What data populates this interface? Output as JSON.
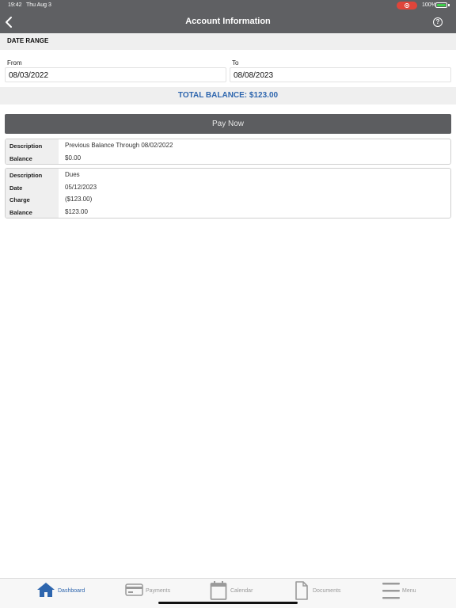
{
  "status_bar": {
    "time": "19:42",
    "date": "Thu Aug 3",
    "battery": "100%"
  },
  "nav": {
    "title": "Account Information"
  },
  "date_range": {
    "heading": "DATE RANGE",
    "from_label": "From",
    "from_value": "08/03/2022",
    "to_label": "To",
    "to_value": "08/08/2023"
  },
  "total_balance": "TOTAL BALANCE: $123.00",
  "pay_button_label": "Pay Now",
  "transactions": [
    {
      "rows": [
        {
          "key": "Description",
          "value": "Previous Balance Through 08/02/2022"
        },
        {
          "key": "Balance",
          "value": "$0.00"
        }
      ]
    },
    {
      "rows": [
        {
          "key": "Description",
          "value": "Dues"
        },
        {
          "key": "Date",
          "value": "05/12/2023"
        },
        {
          "key": "Charge",
          "value": "($123.00)"
        },
        {
          "key": "Balance",
          "value": "$123.00"
        }
      ]
    }
  ],
  "tabs": [
    {
      "label": "Dashboard",
      "icon": "home-icon",
      "active": true
    },
    {
      "label": "Payments",
      "icon": "credit-card-icon",
      "active": false
    },
    {
      "label": "Calendar",
      "icon": "calendar-icon",
      "active": false
    },
    {
      "label": "Documents",
      "icon": "document-icon",
      "active": false
    },
    {
      "label": "Menu",
      "icon": "menu-icon",
      "active": false
    }
  ],
  "colors": {
    "header": "#5f6063",
    "accent": "#2e66ae",
    "pay_button": "#5c5d60",
    "record_indicator": "#e0453a",
    "battery": "#3ecf4b"
  }
}
